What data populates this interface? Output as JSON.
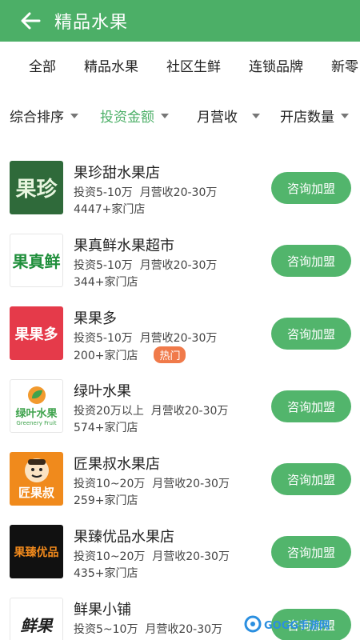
{
  "header": {
    "title": "精品水果",
    "back_icon": "arrow-left-icon"
  },
  "category_tabs": [
    "全部",
    "精品水果",
    "社区生鲜",
    "连锁品牌",
    "新零"
  ],
  "filters": [
    {
      "label": "综合排序",
      "active": false
    },
    {
      "label": "投资金额",
      "active": true
    },
    {
      "label": "月营收",
      "active": false
    },
    {
      "label": "开店数量",
      "active": false
    }
  ],
  "colors": {
    "primary": "#4caf67",
    "button": "#52b56c",
    "hot": "#f07a4a"
  },
  "items": [
    {
      "name": "果珍甜水果店",
      "invest": "投资5-10万",
      "revenue": "月营收20-30万",
      "stores": "4447+家门店",
      "hot": "",
      "logo_text": "果珍",
      "button": "咨询加盟"
    },
    {
      "name": "果真鲜水果超市",
      "invest": "投资5-10万",
      "revenue": "月营收20-30万",
      "stores": "344+家门店",
      "hot": "",
      "logo_text": "果真鲜",
      "button": "咨询加盟"
    },
    {
      "name": "果果多",
      "invest": "投资5-10万",
      "revenue": "月营收20-30万",
      "stores": "200+家门店",
      "hot": "热门",
      "logo_text": "果果多",
      "button": "咨询加盟"
    },
    {
      "name": "绿叶水果",
      "invest": "投资20万以上",
      "revenue": "月营收20-30万",
      "stores": "574+家门店",
      "hot": "",
      "logo_text": "绿叶水果",
      "logo_sub": "Greenery Fruit",
      "button": "咨询加盟"
    },
    {
      "name": "匠果叔水果店",
      "invest": "投资10~20万",
      "revenue": "月营收20-30万",
      "stores": "259+家门店",
      "hot": "",
      "logo_text": "匠果叔",
      "button": "咨询加盟"
    },
    {
      "name": "果臻优品水果店",
      "invest": "投资10~20万",
      "revenue": "月营收20-30万",
      "stores": "435+家门店",
      "hot": "",
      "logo_text": "果臻优品",
      "button": "咨询加盟"
    },
    {
      "name": "鲜果小铺",
      "invest": "投资5~10万",
      "revenue": "月营收20-30万",
      "stores": "",
      "hot": "",
      "logo_text": "鲜果",
      "button": "咨询加盟"
    }
  ],
  "watermark": "GOGG手游网"
}
